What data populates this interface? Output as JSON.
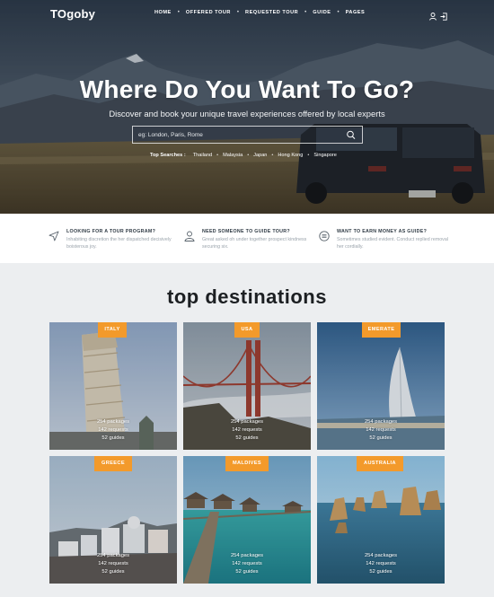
{
  "brand": {
    "logo": "TOgoby"
  },
  "nav": {
    "items": [
      "HOME",
      "OFFERED TOUR",
      "REQUESTED TOUR",
      "GUIDE",
      "PAGES"
    ],
    "icons": [
      "user-icon",
      "login-icon"
    ]
  },
  "hero": {
    "title": "Where Do You Want To Go?",
    "subtitle": "Discover and book your unique travel experiences offered by local experts",
    "search": {
      "placeholder": "eg: London, Paris, Rome",
      "button_icon": "search-icon"
    },
    "top_searches": {
      "label": "Top Searches :",
      "items": [
        "Thailand",
        "Malaysia",
        "Japan",
        "Hong Kong",
        "Singapore"
      ]
    }
  },
  "features": [
    {
      "icon": "location-arrow-icon",
      "title": "LOOKING FOR A TOUR PROGRAM?",
      "desc": "Inhabiting discretion the her dispatched decisively boisterous joy."
    },
    {
      "icon": "guide-person-icon",
      "title": "NEED SOMEONE TO GUIDE TOUR?",
      "desc": "Great asked oh under together prospect kindness securing six."
    },
    {
      "icon": "money-icon",
      "title": "WANT TO EARN MONEY AS GUIDE?",
      "desc": "Sometimes studied evident. Conduct replied removal her cordially."
    }
  ],
  "destinations": {
    "title": "top destinations",
    "cards": [
      {
        "name": "ITALY",
        "packages": "254 packages",
        "requests": "142 requests",
        "guides": "52 guides"
      },
      {
        "name": "USA",
        "packages": "254 packages",
        "requests": "142 requests",
        "guides": "52 guides"
      },
      {
        "name": "EMERATE",
        "packages": "254 packages",
        "requests": "142 requests",
        "guides": "52 guides"
      },
      {
        "name": "GREECE",
        "packages": "254 packages",
        "requests": "142 requests",
        "guides": "52 guides"
      },
      {
        "name": "MALDIVES",
        "packages": "254 packages",
        "requests": "142 requests",
        "guides": "52 guides"
      },
      {
        "name": "AUSTRALIA",
        "packages": "254 packages",
        "requests": "142 requests",
        "guides": "52 guides"
      }
    ]
  },
  "colors": {
    "accent": "#f39a2b",
    "title_text": "#1c1f22",
    "section_bg": "#eceef0"
  }
}
